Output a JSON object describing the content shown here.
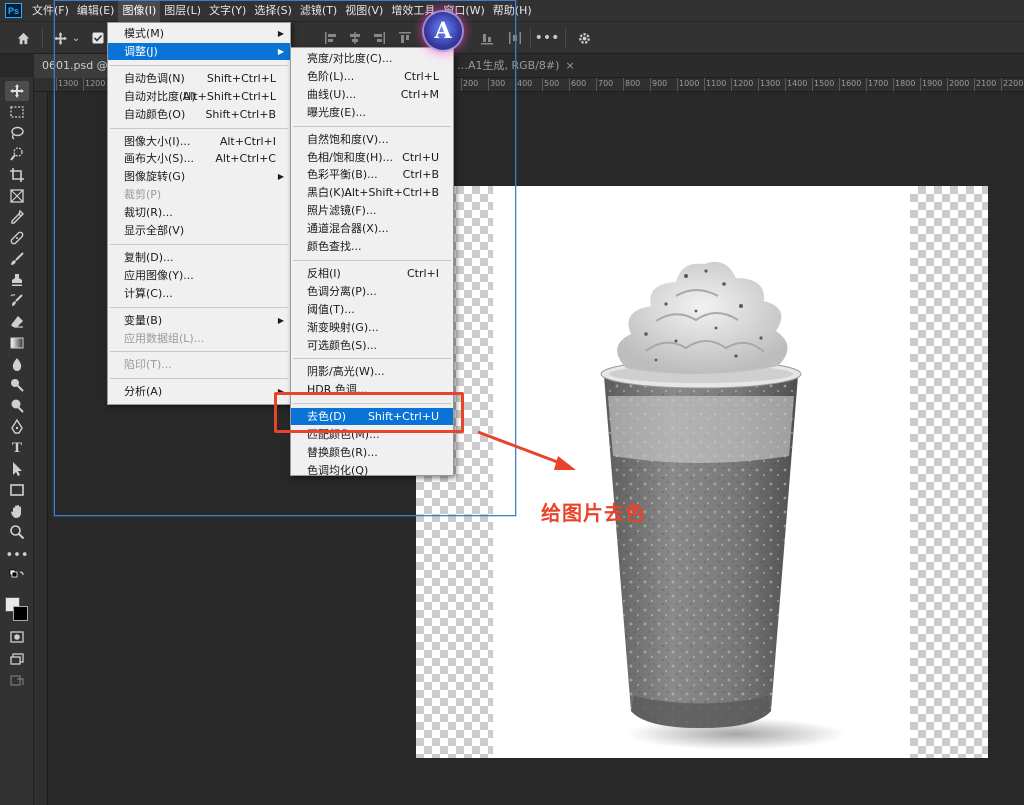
{
  "menubar": {
    "logo": "Ps",
    "items": [
      "文件(F)",
      "编辑(E)",
      "图像(I)",
      "图层(L)",
      "文字(Y)",
      "选择(S)",
      "滤镜(T)",
      "视图(V)",
      "增效工具",
      "窗口(W)",
      "帮助(H)"
    ]
  },
  "tabs": {
    "doc1": "0601.psd @ 33",
    "doc2": "…A1生成, RGB/8#)",
    "close": "×"
  },
  "ruler": {
    "labels": [
      "1300",
      "1200",
      "1100",
      "1000",
      "900",
      "800",
      "700",
      "600",
      "500",
      "400",
      "300",
      "200",
      "100",
      "0",
      "100",
      "200",
      "300",
      "400",
      "500",
      "600",
      "700",
      "800",
      "900",
      "1000",
      "1100",
      "1200",
      "1300",
      "1400",
      "1500",
      "1600",
      "1700",
      "1800",
      "1900",
      "2000",
      "2100",
      "2200",
      "2300"
    ]
  },
  "image_menu": {
    "items": [
      {
        "label": "模式(M)",
        "shortcut": "",
        "submenu": true,
        "disabled": false,
        "highlight": false
      },
      {
        "label": "调整(J)",
        "shortcut": "",
        "submenu": true,
        "disabled": false,
        "highlight": true
      },
      {
        "sep": true
      },
      {
        "label": "自动色调(N)",
        "shortcut": "Shift+Ctrl+L"
      },
      {
        "label": "自动对比度(U)",
        "shortcut": "Alt+Shift+Ctrl+L"
      },
      {
        "label": "自动颜色(O)",
        "shortcut": "Shift+Ctrl+B"
      },
      {
        "sep": true
      },
      {
        "label": "图像大小(I)...",
        "shortcut": "Alt+Ctrl+I"
      },
      {
        "label": "画布大小(S)...",
        "shortcut": "Alt+Ctrl+C"
      },
      {
        "label": "图像旋转(G)",
        "shortcut": "",
        "submenu": true
      },
      {
        "label": "裁剪(P)",
        "shortcut": "",
        "disabled": true
      },
      {
        "label": "裁切(R)...",
        "shortcut": ""
      },
      {
        "label": "显示全部(V)",
        "shortcut": ""
      },
      {
        "sep": true
      },
      {
        "label": "复制(D)...",
        "shortcut": ""
      },
      {
        "label": "应用图像(Y)...",
        "shortcut": ""
      },
      {
        "label": "计算(C)...",
        "shortcut": ""
      },
      {
        "sep": true
      },
      {
        "label": "变量(B)",
        "shortcut": "",
        "submenu": true
      },
      {
        "label": "应用数据组(L)...",
        "shortcut": "",
        "disabled": true
      },
      {
        "sep": true
      },
      {
        "label": "陷印(T)...",
        "shortcut": "",
        "disabled": true
      },
      {
        "sep": true
      },
      {
        "label": "分析(A)",
        "shortcut": "",
        "submenu": true
      }
    ]
  },
  "adjust_menu": {
    "items": [
      {
        "label": "亮度/对比度(C)...",
        "shortcut": ""
      },
      {
        "label": "色阶(L)...",
        "shortcut": "Ctrl+L"
      },
      {
        "label": "曲线(U)...",
        "shortcut": "Ctrl+M"
      },
      {
        "label": "曝光度(E)...",
        "shortcut": ""
      },
      {
        "sep": true
      },
      {
        "label": "自然饱和度(V)...",
        "shortcut": ""
      },
      {
        "label": "色相/饱和度(H)...",
        "shortcut": "Ctrl+U"
      },
      {
        "label": "色彩平衡(B)...",
        "shortcut": "Ctrl+B"
      },
      {
        "label": "黑白(K)...",
        "shortcut": "Alt+Shift+Ctrl+B"
      },
      {
        "label": "照片滤镜(F)...",
        "shortcut": ""
      },
      {
        "label": "通道混合器(X)...",
        "shortcut": ""
      },
      {
        "label": "颜色查找...",
        "shortcut": ""
      },
      {
        "sep": true
      },
      {
        "label": "反相(I)",
        "shortcut": "Ctrl+I"
      },
      {
        "label": "色调分离(P)...",
        "shortcut": ""
      },
      {
        "label": "阈值(T)...",
        "shortcut": ""
      },
      {
        "label": "渐变映射(G)...",
        "shortcut": ""
      },
      {
        "label": "可选颜色(S)...",
        "shortcut": ""
      },
      {
        "sep": true
      },
      {
        "label": "阴影/高光(W)...",
        "shortcut": ""
      },
      {
        "label": "HDR 色调...",
        "shortcut": ""
      },
      {
        "sep": true
      },
      {
        "label": "去色(D)",
        "shortcut": "Shift+Ctrl+U",
        "highlight": true
      },
      {
        "label": "匹配颜色(M)...",
        "shortcut": ""
      },
      {
        "label": "替换颜色(R)...",
        "shortcut": ""
      },
      {
        "label": "色调均化(Q)",
        "shortcut": ""
      }
    ]
  },
  "annotation": {
    "text": "给图片去色",
    "color": "#e8442a"
  },
  "badge": {
    "letter": "A"
  },
  "colors": {
    "highlight": "#0a74d6",
    "selection": "#3d7cd6",
    "annotation_red": "#e8442a"
  }
}
